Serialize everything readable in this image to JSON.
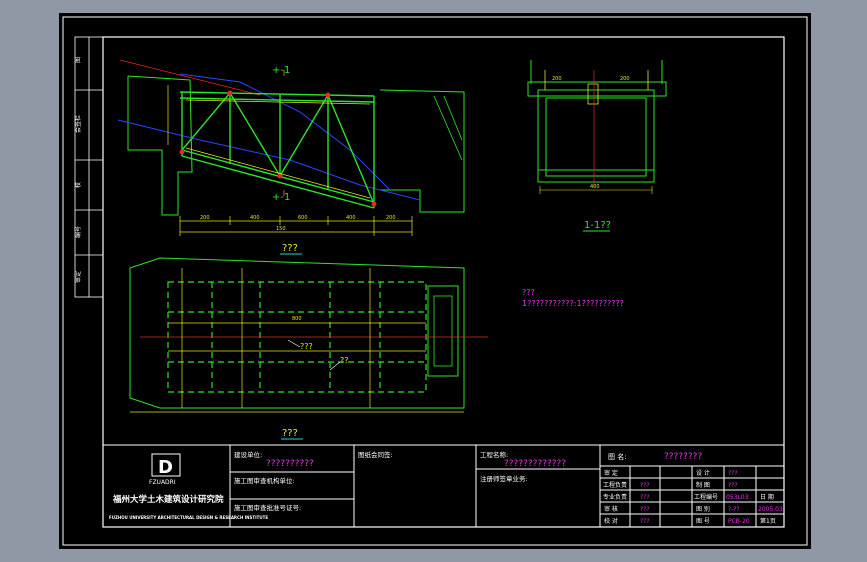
{
  "colors": {
    "background": "#8f98a4",
    "paper": "#000000",
    "frame": "#ffffff",
    "outline": "#28e628",
    "accent_yellow": "#e6e61a",
    "accent_magenta": "#e632e6",
    "accent_cyan": "#1ad6d6",
    "accent_red": "#e62828",
    "accent_blue": "#2846ff"
  },
  "elevation": {
    "mark_top": "+-1",
    "mark_bottom": "+-1",
    "title": "???",
    "dims": [
      "200",
      "400",
      "600",
      "400",
      "200",
      "150"
    ]
  },
  "section": {
    "title": "1-1??",
    "dims_top": [
      "200",
      "200"
    ],
    "dim_bottom": "400"
  },
  "plan": {
    "title": "???",
    "label_a": "???",
    "label_b": "??",
    "dim": "800"
  },
  "notes": {
    "title": "???",
    "line1": "1???????????:1??????????"
  },
  "title_block": {
    "logo_text": "FZUADRI",
    "org_cn": "福州大学土木建筑设计研究院",
    "org_en": "FUZHOU UNIVERSITY ARCHITECTURAL DESIGN & RESEARCH INSTITUTE",
    "build_unit_label": "建设单位:",
    "build_unit_value": "??????????",
    "construction_unit_label": "施工图审查机构单位:",
    "cert_label": "施工图审查批准号证号:",
    "stamp_label": "图纸会同签:",
    "project_label": "工程名称:",
    "project_value": "?????????????",
    "note_label": "注册师签章业务:",
    "drawing_label": "图  名:",
    "drawing_value": "????????",
    "rows": [
      {
        "l": "审  定",
        "lv": "",
        "r": "设  计",
        "rv": "???"
      },
      {
        "l": "工程负责",
        "lv": "???",
        "r": "制  图",
        "rv": "???"
      },
      {
        "l": "专业负责",
        "lv": "???",
        "r": "工程编号",
        "rv": "053L03",
        "x": "日  期",
        "xv": "2005.03"
      },
      {
        "l": "审  核",
        "lv": "???",
        "r": "图  别",
        "rv": "?-??",
        "x": "",
        "xv": "2005.03"
      },
      {
        "l": "校  对",
        "lv": "???",
        "r": "图  号",
        "rv": "PCB-20",
        "x": "第1页",
        "xv": ""
      }
    ]
  },
  "sidebar": {
    "labels": [
      "图",
      "会签栏",
      "校",
      "编号",
      "审定"
    ]
  }
}
